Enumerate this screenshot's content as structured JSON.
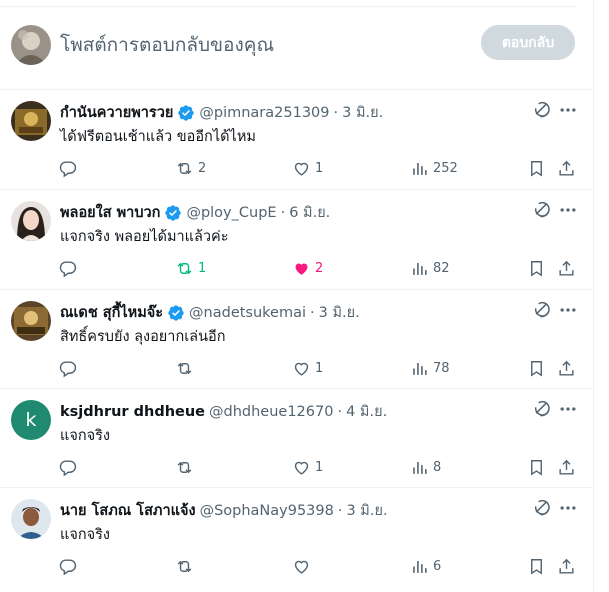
{
  "composer": {
    "placeholder": "โพสต์การตอบกลับของคุณ",
    "reply_label": "ตอบกลับ"
  },
  "colors": {
    "verified": "#1d9bf0",
    "retweeted": "#00ba7c",
    "liked": "#f91880",
    "text_secondary": "#536471",
    "button_disabled": "#cfd9de"
  },
  "tweets": [
    {
      "name": "กำนันควายพารวย",
      "verified": true,
      "handle": "@pimnara251309",
      "separator": "·",
      "date": "3 มิ.ย.",
      "text": "ได้ฟรีตอนเช้าแล้ว ขออีกได้ไหม",
      "replies": "",
      "retweets": "2",
      "likes": "1",
      "views": "252",
      "retweeted": false,
      "liked": false
    },
    {
      "name": "พลอยใส พาบวก",
      "verified": true,
      "handle": "@ploy_CupE",
      "separator": "·",
      "date": "6 มิ.ย.",
      "text": "แจกจริง พลอยได้มาแล้วค่ะ",
      "replies": "",
      "retweets": "1",
      "likes": "2",
      "views": "82",
      "retweeted": true,
      "liked": true
    },
    {
      "name": "ณเดช สุกี้ไหมจ๊ะ",
      "verified": true,
      "handle": "@nadetsukemai",
      "separator": "·",
      "date": "3 มิ.ย.",
      "text": "สิทธิ์ครบยัง ลุงอยากเล่นอีก",
      "replies": "",
      "retweets": "",
      "likes": "1",
      "views": "78",
      "retweeted": false,
      "liked": false
    },
    {
      "name": "ksjdhrur dhdheue",
      "verified": false,
      "handle": "@dhdheue12670",
      "separator": "·",
      "date": "4 มิ.ย.",
      "text": "แจกจริง",
      "avatar_letter": "k",
      "replies": "",
      "retweets": "",
      "likes": "1",
      "views": "8",
      "retweeted": false,
      "liked": false
    },
    {
      "name": "นาย โสภณ โสภาแจ้ง",
      "verified": false,
      "handle": "@SophaNay95398",
      "separator": "·",
      "date": "3 มิ.ย.",
      "text": "แจกจริง",
      "replies": "",
      "retweets": "",
      "likes": "",
      "views": "6",
      "retweeted": false,
      "liked": false
    }
  ]
}
